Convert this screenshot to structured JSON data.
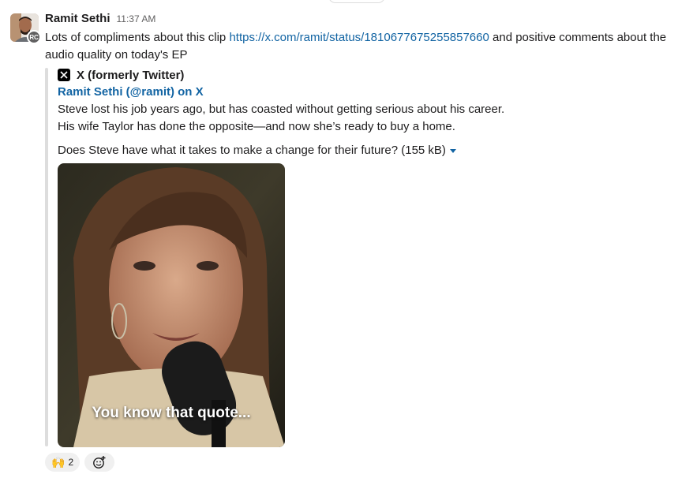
{
  "message": {
    "sender": "Ramit Sethi",
    "time": "11:37 AM",
    "avatar_badge": "RC",
    "text_before": "Lots of compliments about this clip ",
    "link": "https://x.com/ramit/status/1810677675255857660",
    "text_after": " and positive comments about the audio quality on today's EP"
  },
  "unfurl": {
    "service": "X (formerly Twitter)",
    "service_icon": "x-logo-icon",
    "title": "Ramit Sethi (@ramit) on X",
    "body_line1": "Steve lost his job years ago, but has coasted without getting serious about his career.",
    "body_line2": "His wife Taylor has done the opposite—and now she’s ready to buy a home.",
    "file_text": "Does Steve have what it takes to make a change for their future? (155 kB)",
    "video_caption": "You know that quote..."
  },
  "reactions": [
    {
      "emoji": "🙌",
      "count": "2"
    }
  ],
  "add_reaction_icon": "add-emoji-icon",
  "colors": {
    "link": "#1264a3",
    "text": "#1d1c1d",
    "muted": "#616061",
    "bar": "#dddddd"
  }
}
